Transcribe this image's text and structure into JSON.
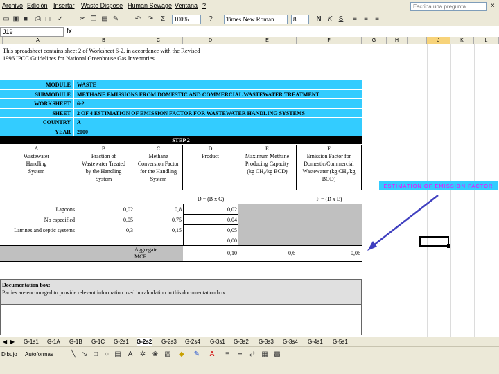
{
  "menu": {
    "items": [
      "Archivo",
      "Edición",
      "Insertar",
      "Waste Dispose",
      "Human Sewage",
      "Ventana",
      "?"
    ],
    "help_placeholder": "Escriba una pregunta",
    "close_glyph": "×"
  },
  "toolbar": {
    "zoom": "100%",
    "font_name": "Times New Roman",
    "font_size": "8"
  },
  "formula_bar": {
    "cell_ref": "J19",
    "fx": "fx"
  },
  "columns": [
    "A",
    "B",
    "C",
    "D",
    "E",
    "F",
    "G",
    "H",
    "I",
    "J",
    "K",
    "L"
  ],
  "intro_text": "This spreadsheet contains sheet 2 of Worksheet 6-2, in accordance with the Revised 1996 IPCC Guidelines for National Greenhouse Gas Inventories",
  "header": {
    "rows": [
      {
        "label": "MODULE",
        "value": "WASTE"
      },
      {
        "label": "SUBMODULE",
        "value": "METHANE EMISSIONS FROM DOMESTIC AND COMMERCIAL WASTEWATER TREATMENT"
      },
      {
        "label": "WORKSHEET",
        "value": "6-2"
      },
      {
        "label": "SHEET",
        "value": "2 OF 4   ESTIMATION OF EMISSION FACTOR FOR WASTEWATER HANDLING SYSTEMS"
      },
      {
        "label": "COUNTRY",
        "value": "A"
      },
      {
        "label": "YEAR",
        "value": "2000"
      }
    ]
  },
  "step_title": "STEP 2",
  "col_headers": [
    {
      "letter": "A",
      "text": "Wastewater Handling System"
    },
    {
      "letter": "B",
      "text": "Fraction of Wastewater Treated by the Handling System"
    },
    {
      "letter": "C",
      "text": "Methane Conversion Factor for the Handling System"
    },
    {
      "letter": "D",
      "text": "Product"
    },
    {
      "letter": "E",
      "text": "Maximum Methane Producing Capacity (kg CH₄/kg BOD)"
    },
    {
      "letter": "F",
      "text": "Emission Factor for Domestic/Commercial Wastewater (kg CH₄/kg BOD)"
    }
  ],
  "formulas": {
    "d": "D = (B x C)",
    "f": "F = (D x E)"
  },
  "rows": [
    {
      "label": "Lagoons",
      "b": "0,02",
      "c": "0,8",
      "d": "0,02"
    },
    {
      "label": "No especified",
      "b": "0,05",
      "c": "0,75",
      "d": "0,04"
    },
    {
      "label": "Latrines and septic systems",
      "b": "0,3",
      "c": "0,15",
      "d": "0,05"
    },
    {
      "label": "",
      "b": "",
      "c": "",
      "d": "0,00"
    }
  ],
  "aggregate": {
    "label_line1": "Aggregate",
    "label_line2": "MCF:",
    "d": "0,10",
    "e": "0,6",
    "f": "0,06"
  },
  "doc_box": {
    "title": "Documentation box:",
    "text": "Parties are encouraged to provide relevant information used in calculation in this documentation box."
  },
  "callout": "ESTIMATION OF EMISSION FACTOR",
  "tabs": [
    "G-1s1",
    "G-1A",
    "G-1B",
    "G-1C",
    "G-2s1",
    "G-2s2",
    "G-2s3",
    "G-2s4",
    "G-3s1",
    "G-3s2",
    "G-3s3",
    "G-3s4",
    "G-4s1",
    "G-5s1"
  ],
  "active_tab": "G-2s2",
  "drawbar": {
    "draw_label": "Dibujo",
    "autoshapes_label": "Autoformas"
  },
  "colors": {
    "header_bg": "#33ccff",
    "callout_text": "#ff00ff",
    "arrow": "#4040c0",
    "gray": "#c0c0c0"
  }
}
